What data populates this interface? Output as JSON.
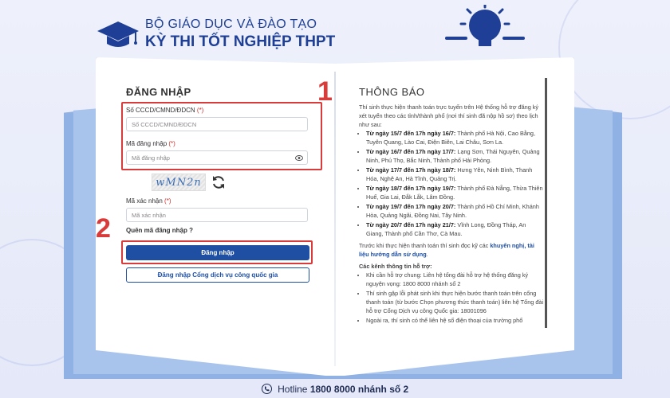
{
  "header": {
    "ministry": "BỘ GIÁO DỤC VÀ ĐÀO TẠO",
    "exam_title": "KỲ THI TỐT NGHIỆP THPT"
  },
  "login": {
    "title": "ĐĂNG NHẬP",
    "id_label": "Số CCCD/CMND/ĐDCN",
    "id_placeholder": "Số CCCD/CMND/ĐDCN",
    "password_label": "Mã đăng nhập",
    "password_placeholder": "Mã đăng nhập",
    "captcha_text": "wMN2n",
    "captcha_label": "Mã xác nhận",
    "captcha_placeholder": "Mã xác nhận",
    "required_mark": "(*)",
    "forgot": "Quên mã đăng nhập ?",
    "submit": "Đăng nhập",
    "gov_login": "Đăng nhập Cổng dịch vụ công quốc gia"
  },
  "annotations": {
    "step1": "1",
    "step2": "2"
  },
  "notice": {
    "title": "THÔNG BÁO",
    "intro": "Thí sinh thực hiện thanh toán trực tuyến trên Hệ thống hỗ trợ đăng ký xét tuyển theo các tỉnh/thành phố (nơi thí sinh đã nộp hồ sơ) theo lịch như sau:",
    "schedule": [
      {
        "date": "Từ ngày 15/7 đến 17h ngày 16/7:",
        "text": " Thành phố Hà Nội, Cao Bằng, Tuyên Quang, Lào Cai, Điện Biên, Lai Châu, Sơn La."
      },
      {
        "date": "Từ ngày 16/7 đến 17h ngày 17/7:",
        "text": " Lạng Sơn, Thái Nguyên, Quảng Ninh, Phú Thọ, Bắc Ninh, Thành phố Hải Phòng."
      },
      {
        "date": "Từ ngày 17/7 đến 17h ngày 18/7:",
        "text": " Hưng Yên, Ninh Bình, Thanh Hóa, Nghệ An, Hà Tĩnh, Quảng Trị."
      },
      {
        "date": "Từ ngày 18/7 đến 17h ngày 19/7:",
        "text": " Thành phố Đà Nẵng, Thừa Thiên Huế, Gia Lai, Đắk Lắk, Lâm Đồng."
      },
      {
        "date": "Từ ngày 19/7 đến 17h ngày 20/7:",
        "text": " Thành phố Hồ Chí Minh, Khánh Hòa, Quảng Ngãi, Đồng Nai, Tây Ninh."
      },
      {
        "date": "Từ ngày 20/7 đến 17h ngày 21/7:",
        "text": " Vĩnh Long, Đồng Tháp, An Giang, Thành phố Cần Thơ, Cà Mau."
      }
    ],
    "advice_prefix": "Trước khi thực hiện thanh toán thí sinh đọc kỹ các ",
    "advice_link": "khuyến nghị, tài liệu hướng dẫn sử dụng",
    "advice_suffix": ".",
    "channels_title": "Các kênh thông tin hỗ trợ:",
    "channels": [
      "Khi cần hỗ trợ chung: Liên hệ tổng đài hỗ trợ hệ thống đăng ký nguyện vọng: 1800 8000 nhánh số 2",
      "Thí sinh gặp lỗi phát sinh khi thực hiện bước thanh toán trên cổng thanh toán (từ bước Chọn phương thức thanh toán) liên hệ Tổng đài hỗ trợ Cổng Dịch vụ công Quốc gia: 18001096",
      "Ngoài ra, thí sinh có thể liên hệ số điện thoại của trường phổ"
    ]
  },
  "footer": {
    "hotline_label": "Hotline",
    "hotline_number": "1800 8000 nhánh số 2"
  },
  "colors": {
    "brand": "#1e3f95",
    "button": "#1e4fa3",
    "annotation": "#d93a3a"
  }
}
